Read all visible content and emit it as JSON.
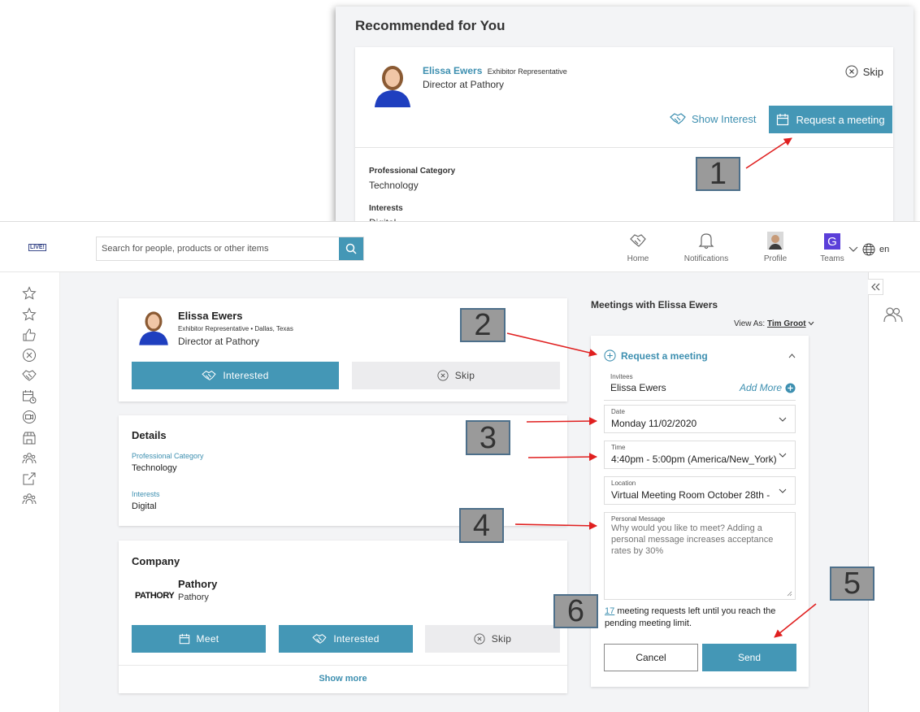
{
  "recommended": {
    "title": "Recommended for You",
    "name": "Elissa Ewers",
    "role": "Exhibitor Representative",
    "subtitle": "Director at Pathory",
    "skip": "Skip",
    "show_interest": "Show Interest",
    "request_meeting": "Request a meeting",
    "prof_category_label": "Professional Category",
    "prof_category_value": "Technology",
    "interests_label": "Interests",
    "interests_value": "Digital"
  },
  "callouts": [
    "1",
    "2",
    "3",
    "4",
    "5",
    "6"
  ],
  "topbar": {
    "logo": "LIVE!",
    "search_placeholder": "Search for people, products or other items",
    "nav": [
      "Home",
      "Notifications",
      "Profile",
      "Teams"
    ],
    "teams_letter": "G",
    "lang": "en"
  },
  "profile_card": {
    "name": "Elissa Ewers",
    "meta": "Exhibitor Representative • Dallas, Texas",
    "subtitle": "Director at Pathory",
    "interested": "Interested",
    "skip": "Skip"
  },
  "details_card": {
    "title": "Details",
    "prof_category_label": "Professional Category",
    "prof_category_value": "Technology",
    "interests_label": "Interests",
    "interests_value": "Digital"
  },
  "company_card": {
    "title": "Company",
    "logo_text": "PATHORY",
    "name": "Pathory",
    "sub": "Pathory",
    "meet": "Meet",
    "interested": "Interested",
    "skip": "Skip",
    "show_more": "Show more"
  },
  "meetings": {
    "title": "Meetings with Elissa Ewers",
    "view_as_label": "View As:",
    "view_as_user": "Tim Groot",
    "request_header": "Request a meeting",
    "invitees_label": "Invitees",
    "invitees_value": "Elissa Ewers",
    "add_more": "Add More",
    "date_label": "Date",
    "date_value": "Monday 11/02/2020",
    "time_label": "Time",
    "time_value": "4:40pm - 5:00pm (America/New_York)",
    "location_label": "Location",
    "location_value": "Virtual Meeting Room October 28th -",
    "message_label": "Personal Message",
    "message_placeholder": "Why would you like to meet? Adding a personal message increases acceptance rates by 30%",
    "requests_left_count": "17",
    "requests_left_text": "meeting requests left until you reach the pending meeting limit.",
    "cancel": "Cancel",
    "send": "Send"
  },
  "colors": {
    "accent": "#4497b6",
    "link": "#3d8fb0",
    "arrow": "#e02020",
    "teams": "#5b3fd9"
  }
}
